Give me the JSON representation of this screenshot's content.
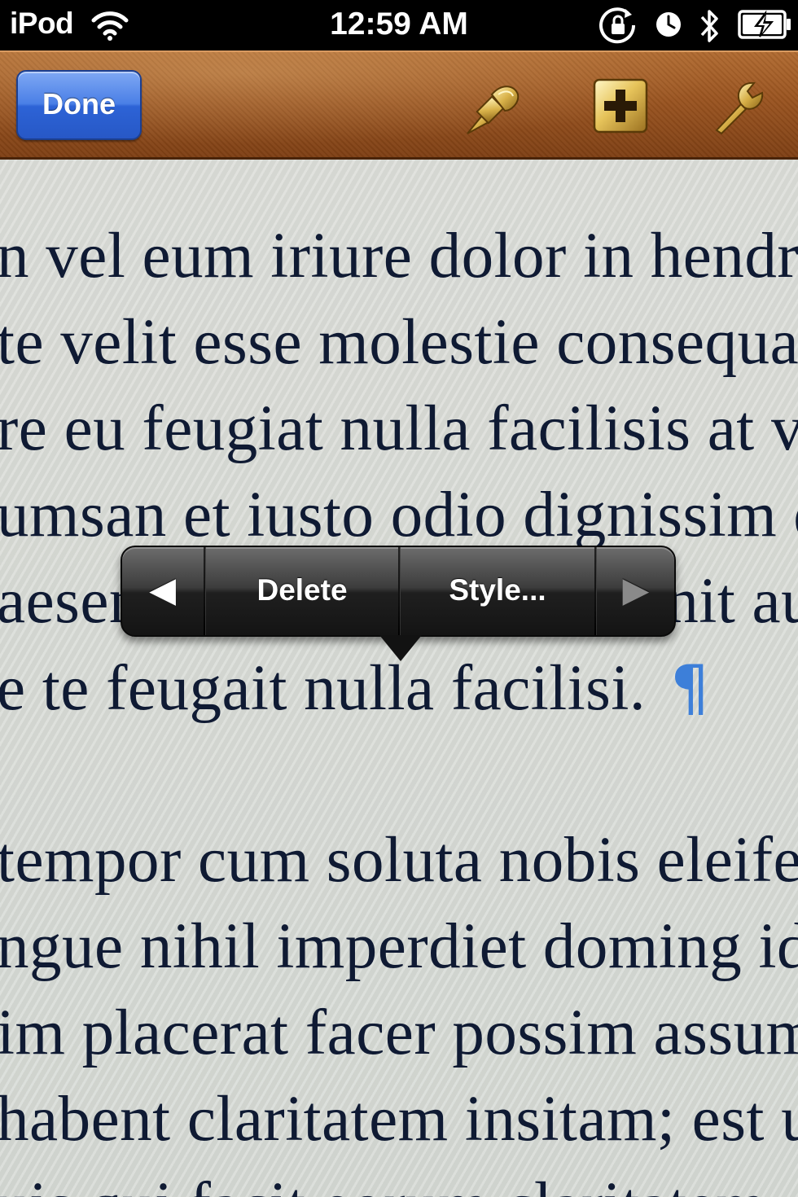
{
  "status_bar": {
    "carrier": "iPod",
    "time": "12:59 AM",
    "icons": [
      "wifi-icon",
      "orientation-lock-icon",
      "alarm-icon",
      "bluetooth-icon",
      "battery-charging-icon"
    ]
  },
  "toolbar": {
    "done_label": "Done",
    "icons": [
      "paintbrush-icon",
      "insert-plus-icon",
      "wrench-icon"
    ],
    "colors": {
      "leather": "#9a5420",
      "done_blue": "#2d63d6"
    }
  },
  "document": {
    "lines": [
      "n vel eum iriure dolor in hendrerit",
      "te velit esse molestie consequat",
      "re eu feugiat nulla facilisis at vero",
      "umsan et iusto odio dignissim qui",
      "aesent luptatum zzril delenit augue",
      "e te feugait nulla facilisi.",
      "",
      " tempor cum soluta nobis eleifend",
      "ngue nihil imperdiet doming id quod",
      "im placerat facer possim assum",
      "habent claritatem insitam; est usus",
      "uis qui facit eorum claritatem"
    ],
    "paragraph_mark": "¶",
    "colors": {
      "text": "#0f1a33",
      "paragraph_mark": "#3d7fd9"
    }
  },
  "edit_menu": {
    "prev_arrow": "◀",
    "delete_label": "Delete",
    "style_label": "Style...",
    "next_arrow": "▶"
  }
}
